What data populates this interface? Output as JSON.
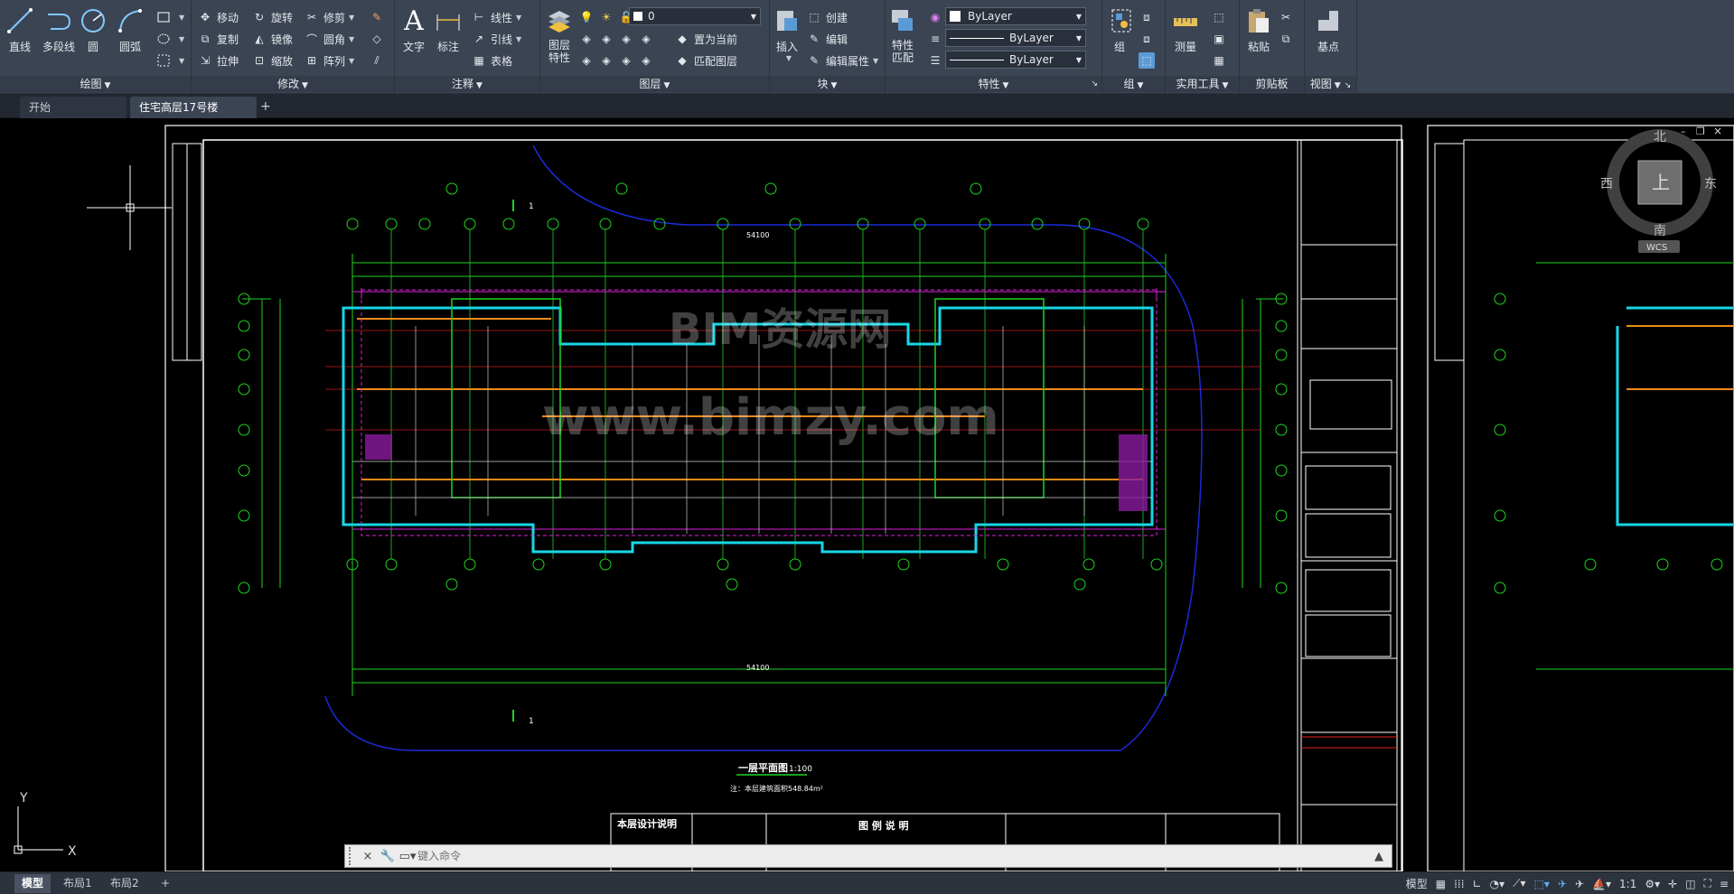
{
  "ribbon": {
    "draw": {
      "title": "绘图",
      "line": "直线",
      "polyline": "多段线",
      "circle": "圆",
      "arc": "圆弧"
    },
    "modify": {
      "title": "修改",
      "move": "移动",
      "rotate": "旋转",
      "trim": "修剪",
      "copy": "复制",
      "mirror": "镜像",
      "fillet": "圆角",
      "stretch": "拉伸",
      "scale": "缩放",
      "array": "阵列"
    },
    "annotation": {
      "title": "注释",
      "text": "文字",
      "dimension": "标注",
      "linear": "线性",
      "leader": "引线",
      "table": "表格"
    },
    "layers": {
      "title": "图层",
      "layer_props": "图层\n特性",
      "layer_props_1": "图层",
      "layer_props_2": "特性",
      "current_layer": "0",
      "set_current": "置为当前",
      "match_layer": "匹配图层"
    },
    "block": {
      "title": "块",
      "insert": "插入",
      "create": "创建",
      "edit": "编辑",
      "edit_attr": "编辑属性"
    },
    "properties": {
      "title": "特性",
      "match_1": "特性",
      "match_2": "匹配",
      "color": "ByLayer",
      "linetype": "ByLayer",
      "lineweight": "ByLayer"
    },
    "groups": {
      "title": "组",
      "group": "组"
    },
    "utilities": {
      "title": "实用工具",
      "measure": "测量"
    },
    "clipboard": {
      "title": "剪贴板",
      "paste": "粘贴"
    },
    "view": {
      "title": "视图",
      "base": "基点"
    }
  },
  "tabs": {
    "start": "开始",
    "drawing": "住宅高层17号楼*"
  },
  "viewcube": {
    "north": "北",
    "south": "南",
    "east": "东",
    "west": "西",
    "top": "上",
    "wcs": "WCS"
  },
  "drawing": {
    "plan_title": "一层平面图",
    "plan_scale": "1:100",
    "area_note": "注：本层建筑面积548.84m²",
    "dim_total": "54100",
    "section_mark": "1",
    "table_heading_1": "本层设计说明",
    "table_heading_2": "图 例 说 明",
    "watermark": "BIM资源网",
    "watermark_url": "www.bimzy.com",
    "ucs_y": "Y",
    "ucs_x": "X"
  },
  "command": {
    "placeholder": "键入命令"
  },
  "layouts": {
    "model": "模型",
    "layout1": "布局1",
    "layout2": "布局2"
  },
  "status": {
    "model": "模型",
    "scale": "1:1"
  }
}
